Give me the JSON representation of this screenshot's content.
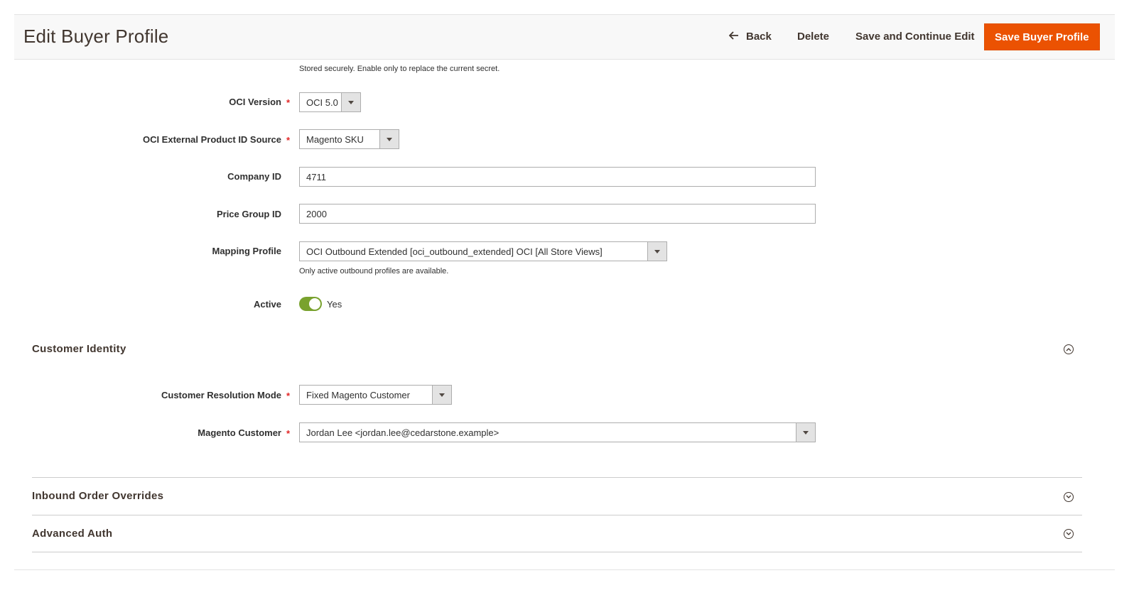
{
  "header": {
    "title": "Edit Buyer Profile",
    "back_label": "Back",
    "delete_label": "Delete",
    "save_continue_label": "Save and Continue Edit",
    "save_label": "Save Buyer Profile",
    "accent_color": "#eb5202"
  },
  "form": {
    "secret_help": "Stored securely. Enable only to replace the current secret.",
    "oci_version": {
      "label": "OCI Version",
      "value": "OCI 5.0",
      "required": true
    },
    "oci_ext_product_id": {
      "label": "OCI External Product ID Source",
      "value": "Magento SKU",
      "required": true
    },
    "company_id": {
      "label": "Company ID",
      "value": "4711"
    },
    "price_group_id": {
      "label": "Price Group ID",
      "value": "2000"
    },
    "mapping_profile": {
      "label": "Mapping Profile",
      "value": "OCI Outbound Extended [oci_outbound_extended] OCI [All Store Views]",
      "help": "Only active outbound profiles are available."
    },
    "active": {
      "label": "Active",
      "value_label": "Yes",
      "checked": true,
      "color": "#79a22e"
    }
  },
  "customer_identity": {
    "title": "Customer Identity",
    "expanded": true,
    "resolution_mode": {
      "label": "Customer Resolution Mode",
      "value": "Fixed Magento Customer",
      "required": true
    },
    "magento_customer": {
      "label": "Magento Customer",
      "value": "Jordan Lee <jordan.lee@cedarstone.example>",
      "required": true
    }
  },
  "collapsed_sections": [
    {
      "title": "Inbound Order Overrides"
    },
    {
      "title": "Advanced Auth"
    }
  ],
  "required_marker": "*",
  "icons": {
    "back": "arrow-left-icon",
    "collapse": "chevron-up-circle-icon",
    "expand": "chevron-down-circle-icon",
    "select": "caret-down-icon"
  }
}
